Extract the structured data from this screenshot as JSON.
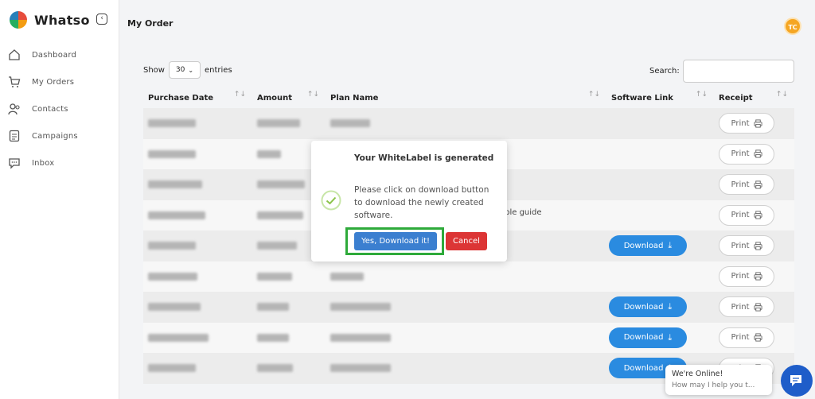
{
  "app": {
    "name": "Whatso"
  },
  "sidebar": {
    "items": [
      {
        "label": "Dashboard",
        "icon": "home-icon"
      },
      {
        "label": "My Orders",
        "icon": "cart-icon"
      },
      {
        "label": "Contacts",
        "icon": "contacts-icon"
      },
      {
        "label": "Campaigns",
        "icon": "campaigns-icon"
      },
      {
        "label": "Inbox",
        "icon": "inbox-icon"
      }
    ]
  },
  "header": {
    "title": "My Order",
    "avatar_initials": "TC",
    "avatar_color": "#f5a623"
  },
  "table_controls": {
    "show_label": "Show",
    "entries_value": "30",
    "entries_label": "entries",
    "search_label": "Search:"
  },
  "table": {
    "columns": [
      "Purchase Date",
      "Amount",
      "Plan Name",
      "Software Link",
      "Receipt"
    ],
    "print_label": "Print",
    "download_label": "Download",
    "rows": [
      {
        "download": false
      },
      {
        "download": false
      },
      {
        "download": false
      },
      {
        "download": false
      },
      {
        "download": true
      },
      {
        "download": false
      },
      {
        "download": true
      },
      {
        "download": true
      },
      {
        "download": true
      }
    ]
  },
  "partial_text": "able guide",
  "modal": {
    "title": "Your WhiteLabel is generated",
    "message": "Please click on download button to download the newly created software.",
    "confirm_label": "Yes, Download it!",
    "cancel_label": "Cancel",
    "confirm_color": "#3b7fd0",
    "cancel_color": "#dc3535",
    "highlight_color": "#2eaa3a"
  },
  "chat": {
    "title": "We're Online!",
    "subtitle": "How may I help you t..."
  }
}
